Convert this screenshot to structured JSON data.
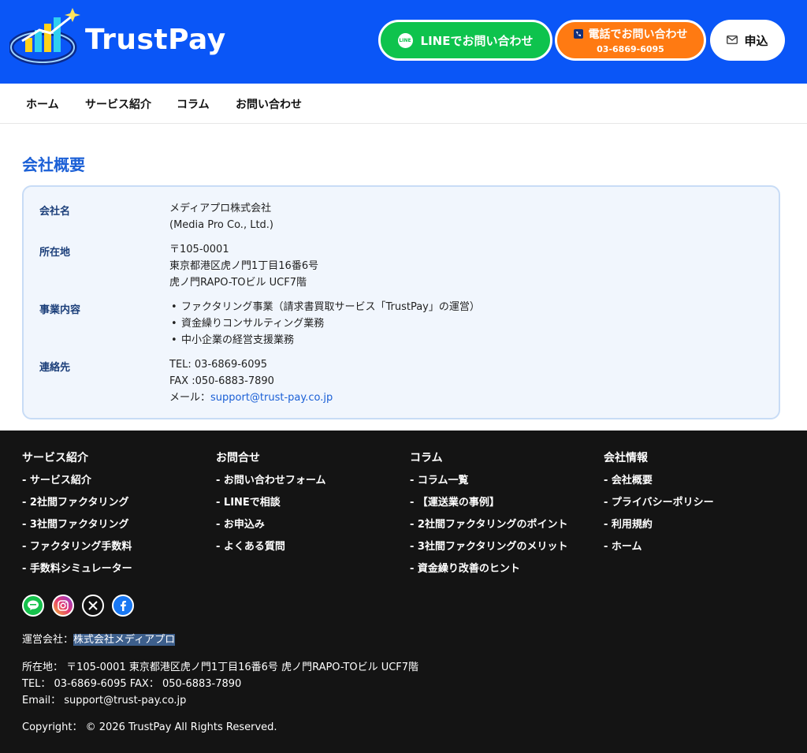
{
  "header": {
    "brand": "TrustPay",
    "line_button": "LINEでお問い合わせ",
    "line_icon_text": "LINE",
    "tel_button": "電話でお問い合わせ",
    "tel_number": "03-6869-6095",
    "apply_button": "申込"
  },
  "nav": [
    "ホーム",
    "サービス紹介",
    "コラム",
    "お問い合わせ"
  ],
  "main": {
    "title": "会社概要",
    "company_label": "会社名",
    "company_name": "メディアプロ株式会社",
    "company_name_en": "(Media Pro Co., Ltd.)",
    "address_label": "所在地",
    "address_lines": [
      "〒105-0001",
      "東京都港区虎ノ門1丁目16番6号",
      "虎ノ門RAPO-TOビル UCF7階"
    ],
    "business_label": "事業内容",
    "business_items": [
      "ファクタリング事業（請求書買取サービス「TrustPay」の運営）",
      "資金繰りコンサルティング業務",
      "中小企業の経営支援業務"
    ],
    "contact_label": "連絡先",
    "tel": "TEL: 03-6869-6095",
    "fax": "FAX :050-6883-7890",
    "mail_label": "メール：",
    "mail": "support@trust-pay.co.jp"
  },
  "footer": {
    "columns": [
      {
        "title": "サービス紹介",
        "links": [
          "- サービス紹介",
          "- 2社間ファクタリング",
          "- 3社間ファクタリング",
          "- ファクタリング手数料",
          "- 手数料シミュレーター"
        ]
      },
      {
        "title": "お問合せ",
        "links": [
          "- お問い合わせフォーム",
          "- LINEで相談",
          "- お申込み",
          "- よくある質問"
        ]
      },
      {
        "title": "コラム",
        "links": [
          "- コラム一覧",
          "- 【運送業の事例】",
          "- 2社間ファクタリングのポイント",
          "- 3社間ファクタリングのメリット",
          "- 資金繰り改善のヒント"
        ]
      },
      {
        "title": "会社情報",
        "links": [
          "- 会社概要",
          "- プライバシーポリシー",
          "- 利用規約",
          "- ホーム"
        ]
      }
    ],
    "operator_label": "運営会社：",
    "operator_name": "株式会社メディアプロ",
    "address": "所在地： 〒105-0001 東京都港区虎ノ門1丁目16番6号 虎ノ門RAPO-TOビル UCF7階",
    "telfax": "TEL： 03-6869-6095 FAX： 050-6883-7890",
    "email": "Email： support@trust-pay.co.jp",
    "copyright": "Copyright： © 2026 TrustPay All Rights Reserved."
  },
  "colors": {
    "header_bg": "#0a56f7",
    "line_green": "#0ec34d",
    "tel_orange": "#ff7a12",
    "title_blue": "#1a5fd6",
    "footer_bg": "#141414"
  },
  "icons": [
    "logo-icon",
    "line-icon",
    "phone-icon",
    "mail-icon",
    "line-social-icon",
    "instagram-icon",
    "x-icon",
    "facebook-icon"
  ]
}
